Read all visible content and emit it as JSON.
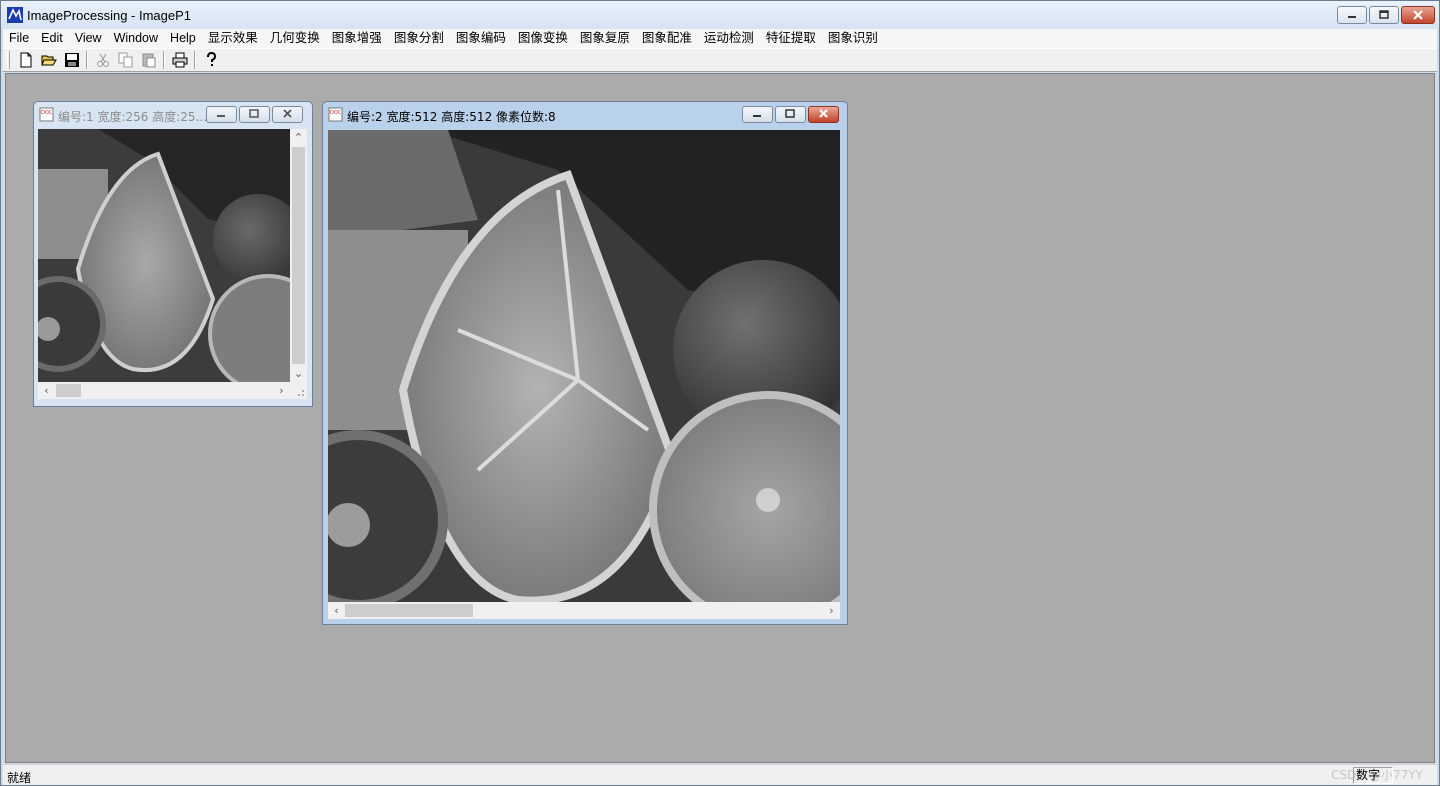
{
  "app": {
    "title": "ImageProcessing - ImageP1"
  },
  "menu": [
    "File",
    "Edit",
    "View",
    "Window",
    "Help",
    "显示效果",
    "几何变换",
    "图象增强",
    "图象分割",
    "图象编码",
    "图像变换",
    "图象复原",
    "图象配准",
    "运动检测",
    "特征提取",
    "图象识别"
  ],
  "toolbar": {
    "buttons": [
      "new-icon",
      "open-icon",
      "save-icon",
      "cut-icon",
      "copy-icon",
      "paste-icon",
      "print-icon",
      "help-icon"
    ]
  },
  "windows": [
    {
      "title": "编号:1 宽度:256 高度:25...",
      "active": false
    },
    {
      "title": "编号:2 宽度:512 高度:512 像素位数:8",
      "active": true
    }
  ],
  "status": {
    "text": "就绪",
    "pane1": "数字",
    "watermark": "CSDN @小77YY"
  },
  "colors": {
    "mdi_background": "#ababab",
    "active_caption": "#b9d1ea",
    "inactive_caption": "#d7e4f2"
  }
}
